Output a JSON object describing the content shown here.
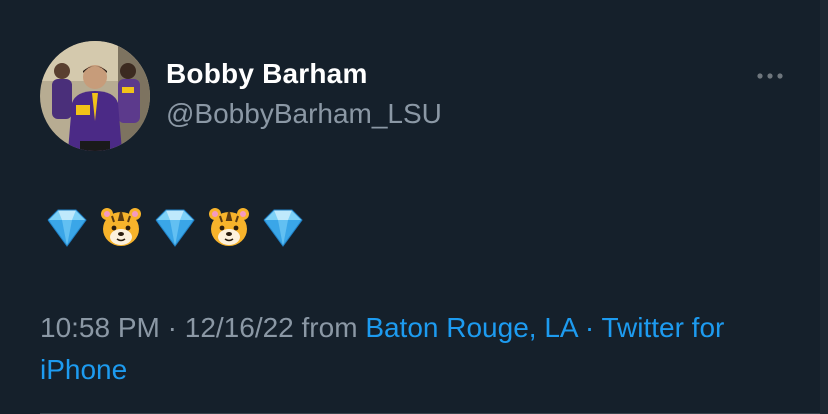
{
  "user": {
    "display_name": "Bobby Barham",
    "handle": "@BobbyBarham_LSU",
    "avatar_icon": "profile-photo"
  },
  "tweet": {
    "emojis": [
      "gem-stone-icon",
      "tiger-face-icon",
      "gem-stone-icon",
      "tiger-face-icon",
      "gem-stone-icon"
    ],
    "time": "10:58 PM",
    "separator1": " · ",
    "date": "12/16/22",
    "from_text": " from ",
    "location": "Baton Rouge, LA",
    "separator2": " · ",
    "source": "Twitter for iPhone"
  },
  "actions": {
    "more_icon": "more-dots-icon"
  },
  "colors": {
    "background": "#15202b",
    "secondary_text": "#8b98a5",
    "link": "#1d9bf0"
  }
}
